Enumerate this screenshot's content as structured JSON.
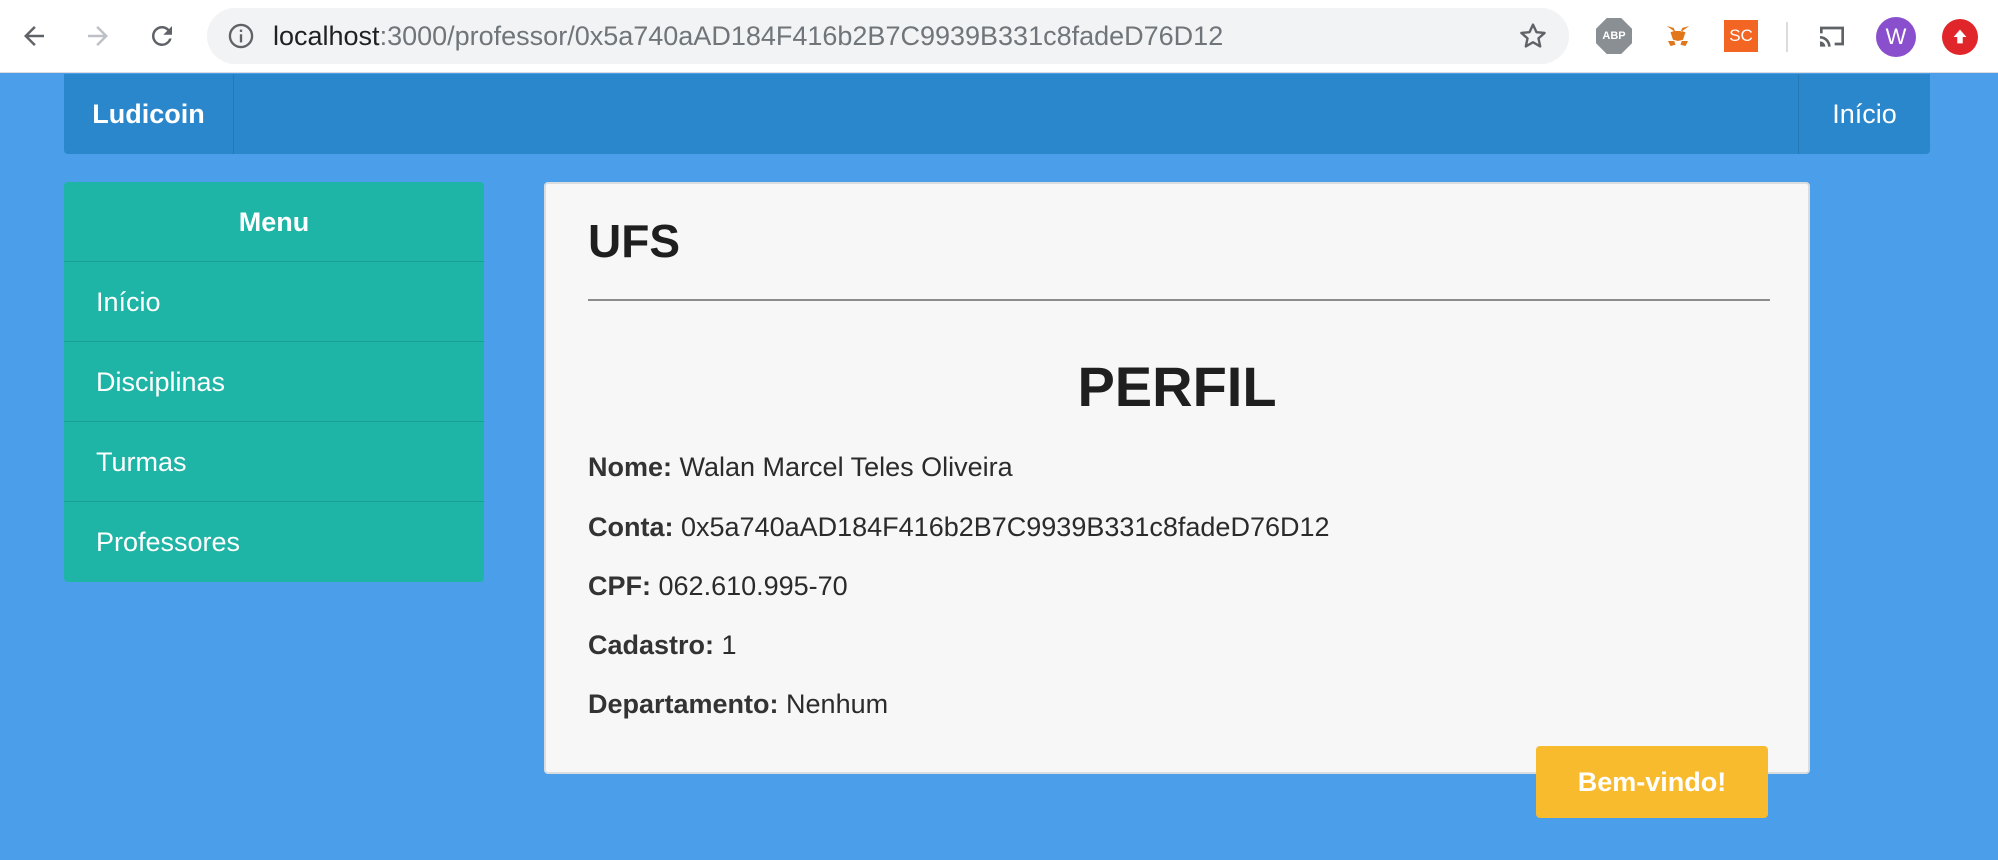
{
  "browser": {
    "url_host": "localhost",
    "url_rest": ":3000/professor/0x5a740aAD184F416b2B7C9939B331c8fadeD76D12",
    "icons": [
      "back-arrow-icon",
      "forward-arrow-icon",
      "reload-icon",
      "info-icon",
      "star-icon",
      "adblock-plus-icon",
      "metamask-fox-icon",
      "sc-extension-icon",
      "cast-icon",
      "profile-avatar",
      "upload-extension-icon"
    ],
    "extension_abp_label": "ABP",
    "extension_sc_label": "SC",
    "avatar_letter": "W"
  },
  "navbar": {
    "brand": "Ludicoin",
    "right_link": "Início",
    "color": "#2a87cc"
  },
  "sidebar": {
    "title": "Menu",
    "color": "#1eb4a6",
    "items": [
      {
        "label": "Início"
      },
      {
        "label": "Disciplinas"
      },
      {
        "label": "Turmas"
      },
      {
        "label": "Professores"
      }
    ]
  },
  "main": {
    "title": "UFS",
    "section_title": "PERFIL",
    "fields": [
      {
        "label": "Nome:",
        "value": "Walan Marcel Teles Oliveira"
      },
      {
        "label": "Conta:",
        "value": "0x5a740aAD184F416b2B7C9939B331c8fadeD76D12"
      },
      {
        "label": "CPF:",
        "value": "062.610.995-70"
      },
      {
        "label": "Cadastro:",
        "value": "1"
      },
      {
        "label": "Departamento:",
        "value": "Nenhum"
      }
    ]
  },
  "welcome_button": {
    "label": "Bem-vindo!",
    "color": "#f8bb2e"
  },
  "page_background": "#4a9eea"
}
